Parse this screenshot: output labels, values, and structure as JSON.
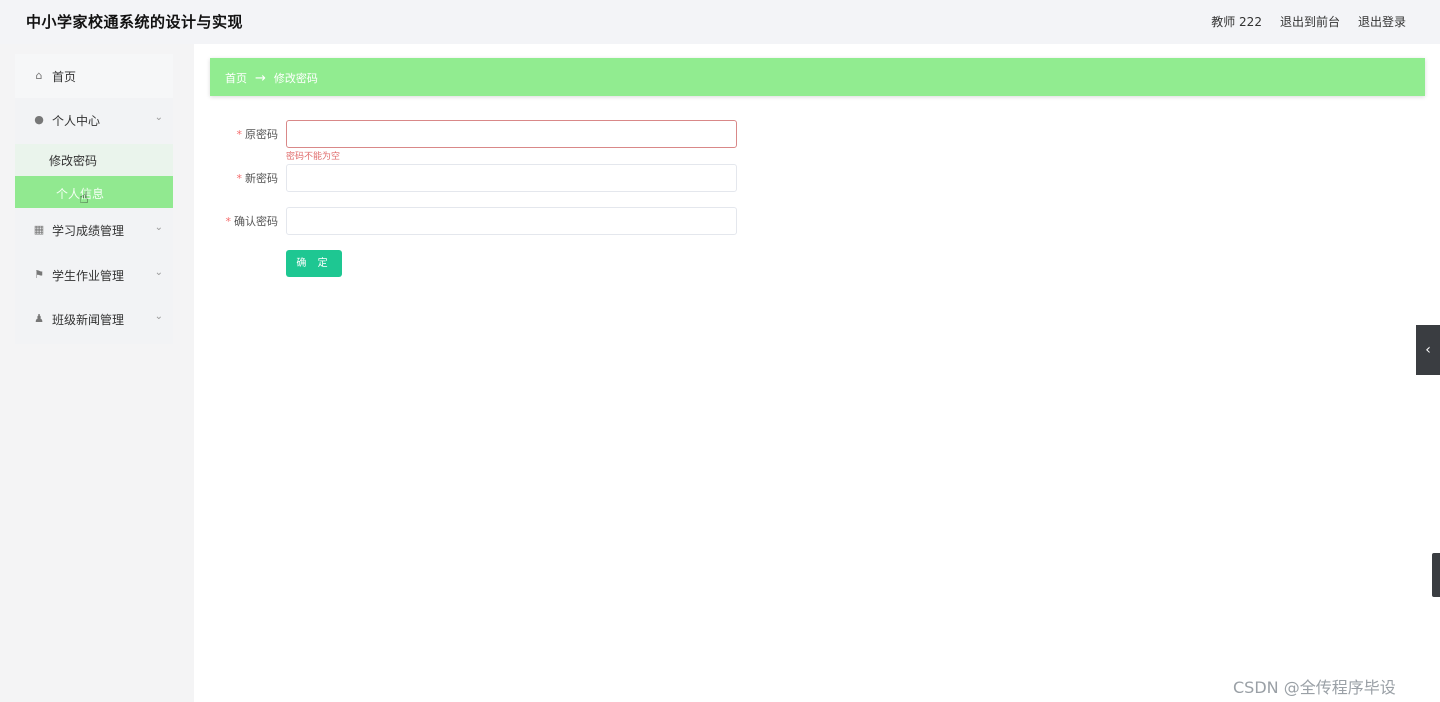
{
  "header": {
    "app_title": "中小学家校通系统的设计与实现",
    "user": "教师 222",
    "back_to_front": "退出到前台",
    "logout": "退出登录"
  },
  "sidebar": {
    "home": "首页",
    "personal_center": "个人中心",
    "change_password": "修改密码",
    "personal_info": "个人信息",
    "grade_mgmt": "学习成绩管理",
    "homework_mgmt": "学生作业管理",
    "news_mgmt": "班级新闻管理"
  },
  "breadcrumb": {
    "home": "首页",
    "arrow": "→",
    "current": "修改密码"
  },
  "form": {
    "old_password_label": "原密码",
    "old_password_error": "密码不能为空",
    "new_password_label": "新密码",
    "confirm_password_label": "确认密码",
    "required_mark": "*",
    "submit": "确 定"
  },
  "watermark": {
    "text": "CSDN @全传程序毕设"
  },
  "icons": {
    "home": "home-icon",
    "user": "user-icon",
    "grid": "grid-icon",
    "flag": "flag-icon",
    "person": "person-icon",
    "chevron": "chevron-down-icon",
    "collapse": "chevron-left-icon"
  },
  "colors": {
    "accent_green": "#91ec90",
    "button_green": "#1ec792",
    "error_red": "#e06b6b"
  }
}
